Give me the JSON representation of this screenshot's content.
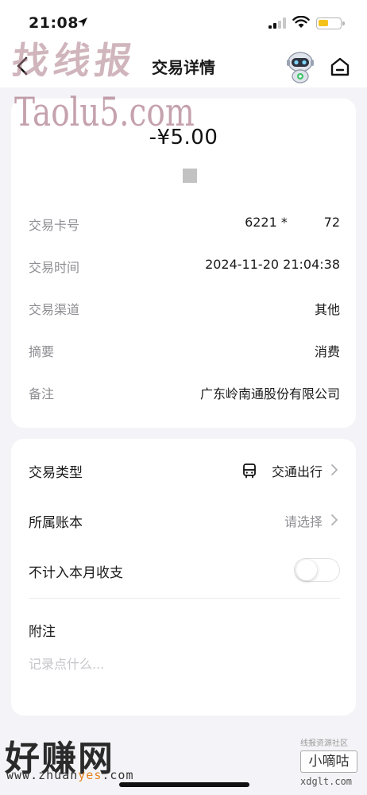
{
  "status_bar": {
    "time": "21:08",
    "battery_level": 0.45,
    "battery_color": "#f4c21b"
  },
  "nav": {
    "title": "交易详情",
    "back_icon": "chevron-left-icon",
    "assistant_icon": "robot-icon",
    "home_icon": "home-icon"
  },
  "transaction": {
    "amount": "-¥5.00",
    "details": [
      {
        "label": "交易卡号",
        "value": "6221 *         72"
      },
      {
        "label": "交易时间",
        "value": "2024-11-20 21:04:38"
      },
      {
        "label": "交易渠道",
        "value": "其他"
      },
      {
        "label": "摘要",
        "value": "消费"
      },
      {
        "label": "备注",
        "value": "广东岭南通股份有限公司"
      }
    ]
  },
  "options": {
    "type_label": "交易类型",
    "type_value": "交通出行",
    "type_icon": "bus-icon",
    "account_label": "所属账本",
    "account_value": "请选择",
    "exclude_label": "不计入本月收支",
    "exclude_on": false,
    "note_label": "附注",
    "note_placeholder": "记录点什么..."
  },
  "watermarks": {
    "top_cn": "找线报",
    "top_en": "Taolu5.com",
    "bottom_cn": "好赚网",
    "bottom_url_pre": "www.zhuan",
    "bottom_url_accent": "yes",
    "bottom_url_post": ".com",
    "right_small": "线报资源社区",
    "right_cn": "小嘀咕",
    "right_url": "xdglt.com"
  }
}
